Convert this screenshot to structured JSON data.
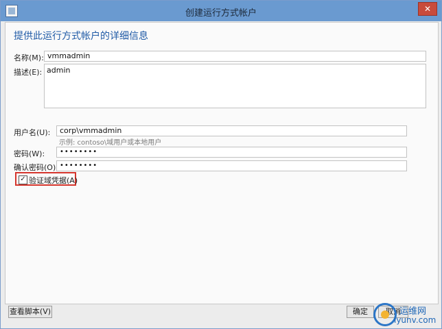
{
  "window": {
    "title": "创建运行方式帐户",
    "close_symbol": "✕"
  },
  "form": {
    "heading": "提供此运行方式帐户的详细信息",
    "name_label": "名称(M):",
    "name_value": "vmmadmin",
    "description_label": "描述(E):",
    "description_value": "admin",
    "username_label": "用户名(U):",
    "username_value": "corp\\vmmadmin",
    "username_hint": "示例: contoso\\域用户或本地用户",
    "password_label": "密码(W):",
    "password_value": "••••••••",
    "confirm_label": "确认密码(O):",
    "confirm_value": "••••••••",
    "validate_checkbox_label": "验证域凭据(A)",
    "validate_checked": true
  },
  "footer": {
    "view_script_label": "查看脚本(V)",
    "ok_label": "确定",
    "cancel_label": "取消"
  },
  "watermark": {
    "top": "运维网",
    "bottom": "iyunv.com"
  },
  "icons": {
    "close": "close-icon",
    "window": "window-icon",
    "check": "checkmark-icon"
  }
}
